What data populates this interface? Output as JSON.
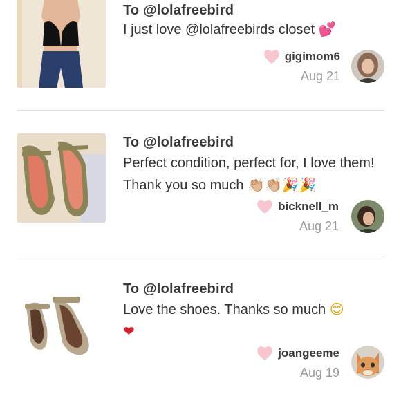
{
  "reviews": [
    {
      "to": "To @lolafreebird",
      "message": "I just love @lolafreebirds closet",
      "message_emoji": "💕",
      "username": "gigimom6",
      "date": "Aug 21",
      "thumb_icon": "product-photo-bralette",
      "avatar_icon": "user-avatar"
    },
    {
      "to": "To @lolafreebird",
      "message": "Perfect condition, perfect for, I love them! Thank you so much",
      "message_emoji": "👏🏼👏🏼🎉🎉",
      "username": "bicknell_m",
      "date": "Aug 21",
      "thumb_icon": "product-photo-flats",
      "avatar_icon": "user-avatar"
    },
    {
      "to": "To @lolafreebird",
      "message": "Love the shoes. Thanks so much",
      "message_emoji": "😊",
      "message_heart": "❤",
      "username": "joangeeme",
      "date": "Aug 19",
      "thumb_icon": "product-photo-flats",
      "avatar_icon": "cat-avatar"
    }
  ],
  "colors": {
    "like_heart": "#f7c6cf",
    "red_heart": "#d81e2c",
    "date_gray": "#9a9a9a",
    "divider": "#dedede"
  }
}
